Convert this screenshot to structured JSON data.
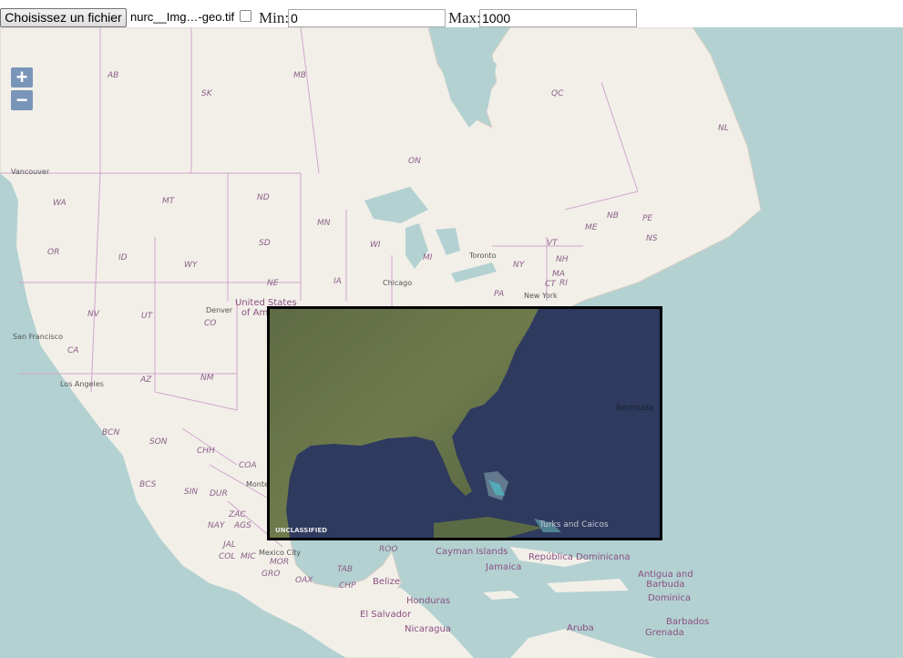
{
  "toolbar": {
    "file_button_label": "Choisissez un fichier",
    "file_name": "nurc__Img…-geo.tif",
    "min_label": "Min:",
    "min_value": "0",
    "max_label": "Max:",
    "max_value": "1000"
  },
  "map": {
    "zoom_in_label": "+",
    "zoom_out_label": "−",
    "state_labels": [
      "AB",
      "SK",
      "MB",
      "QC",
      "NL",
      "ON",
      "WA",
      "MT",
      "ND",
      "MN",
      "NB",
      "PE",
      "ME",
      "NS",
      "OR",
      "ID",
      "SD",
      "WI",
      "MI",
      "VT",
      "NH",
      "NY",
      "MA",
      "CT",
      "RI",
      "WY",
      "NE",
      "IA",
      "PA",
      "NV",
      "UT",
      "CO",
      "CA",
      "AZ",
      "NM",
      "BCN",
      "SON",
      "CHH",
      "COA",
      "BCS",
      "SIN",
      "DUR",
      "ZAC",
      "NAY",
      "AGS",
      "JAL",
      "COL",
      "MIC",
      "GRO",
      "MOR",
      "OAX",
      "CHP",
      "ROO",
      "TAB"
    ],
    "city_labels": [
      "Vancouver",
      "Toronto",
      "Chicago",
      "New York",
      "Denver",
      "San Francisco",
      "Los Angeles",
      "Monterrey",
      "Mexico City"
    ],
    "country_labels": {
      "usa": "United States\nof America",
      "cayman": "Cayman Islands",
      "dominicana": "República Dominicana",
      "jamaica": "Jamaica",
      "belize": "Belize",
      "honduras": "Honduras",
      "el_salvador": "El Salvador",
      "nicaragua": "Nicaragua",
      "antigua": "Antigua and\nBarbuda",
      "dominica": "Dominica",
      "barbados": "Barbados",
      "grenada": "Grenada",
      "aruba": "Aruba"
    }
  },
  "overlay": {
    "bermuda_label": "Bermuda",
    "turks_label": "Turks and Caicos",
    "unclassified_label": "UNCLASSIFIED"
  },
  "colors": {
    "ocean": "#b3d1d1",
    "land": "#f2efe9",
    "border": "#c9a3c7",
    "zoom_bg": "#003c88"
  }
}
